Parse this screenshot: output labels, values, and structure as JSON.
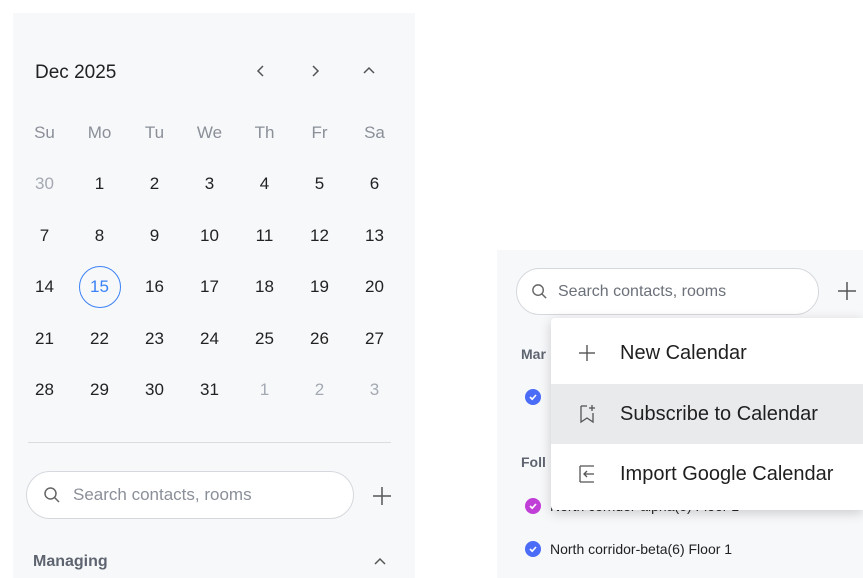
{
  "calendar": {
    "month_label": "Dec 2025",
    "weekdays": [
      "Su",
      "Mo",
      "Tu",
      "We",
      "Th",
      "Fr",
      "Sa"
    ],
    "weeks": [
      [
        "30",
        "1",
        "2",
        "3",
        "4",
        "5",
        "6"
      ],
      [
        "7",
        "8",
        "9",
        "10",
        "11",
        "12",
        "13"
      ],
      [
        "14",
        "15",
        "16",
        "17",
        "18",
        "19",
        "20"
      ],
      [
        "21",
        "22",
        "23",
        "24",
        "25",
        "26",
        "27"
      ],
      [
        "28",
        "29",
        "30",
        "31",
        "1",
        "2",
        "3"
      ]
    ],
    "selected_day": "15",
    "accent_color": "#3b82f6",
    "icons": {
      "prev": "chevron-left-icon",
      "next": "chevron-right-icon",
      "collapse": "chevron-up-icon"
    }
  },
  "left_search": {
    "placeholder": "Search contacts, rooms",
    "value": ""
  },
  "left_sections": {
    "managing": "Managing"
  },
  "right_search": {
    "placeholder": "Search contacts, rooms",
    "value": ""
  },
  "right_sections": {
    "managing_partial": "Mar",
    "following_partial": "Foll"
  },
  "right_calendars": [
    {
      "name": "North corridor-alpha(6) Floor 1",
      "color": "#c03fd6"
    },
    {
      "name": "North corridor-beta(6) Floor 1",
      "color": "#4a6cf7"
    }
  ],
  "add_menu": {
    "items": [
      {
        "label": "New Calendar",
        "icon": "plus-icon"
      },
      {
        "label": "Subscribe to Calendar",
        "icon": "bookmark-add-icon"
      },
      {
        "label": "Import Google Calendar",
        "icon": "import-icon"
      }
    ]
  }
}
